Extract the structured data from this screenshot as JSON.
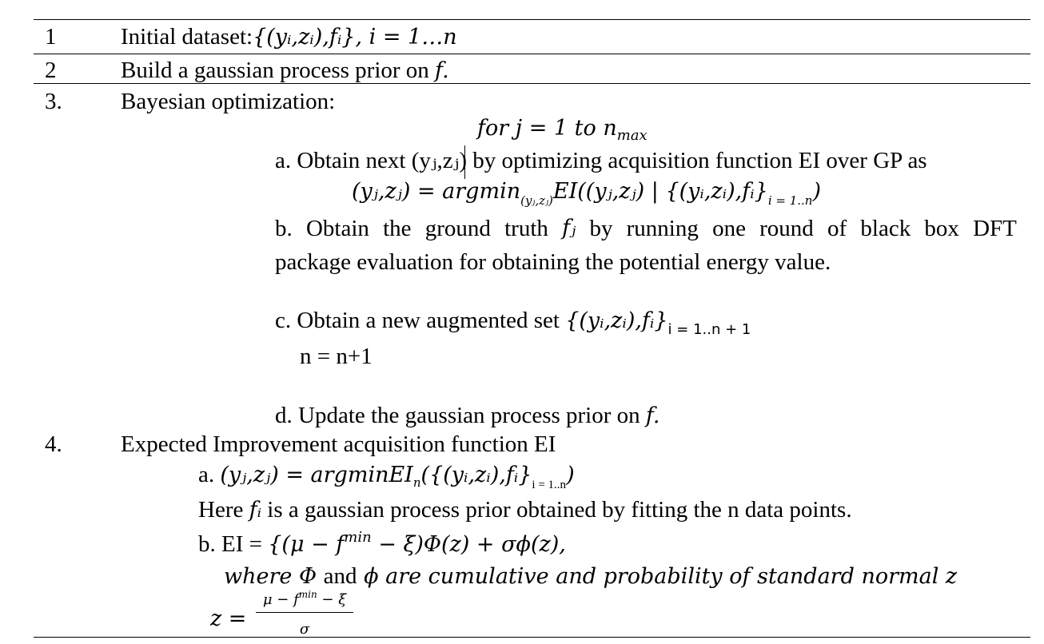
{
  "rows": [
    {
      "num": "1",
      "text": "Initial dataset:",
      "math": "{(yᵢ,zᵢ),fᵢ}, i = 1…n"
    },
    {
      "num": "2",
      "text": "Build a gaussian process prior on ",
      "math": "f."
    },
    {
      "num": "3.",
      "text": "Bayesian optimization:"
    },
    {
      "num": "4.",
      "text": "Expected Improvement acquisition function EI"
    }
  ],
  "step3": {
    "loop": "for j = 1 to n",
    "loop_sub": "max",
    "a_text": "a. Obtain next (yⱼ,zⱼ) by optimizing acquisition function EI over GP as",
    "a_eq": "(yⱼ,zⱼ) =  argmin",
    "a_eq_sub": "(yⱼ,zⱼ)",
    "a_eq_rest": "EI((yⱼ,zⱼ) | {(yᵢ,zᵢ),fᵢ}",
    "a_eq_rest_sub": "i = 1..n",
    "a_eq_close": ")",
    "b_line1_parts": [
      "b.",
      "Obtain",
      "the",
      "ground",
      "truth",
      "fⱼ",
      "by",
      "running",
      "one",
      "round",
      "of",
      "black",
      "box",
      "DFT"
    ],
    "b_line2": "package evaluation for obtaining the potential energy value.",
    "c_text": "c. Obtain a new augmented set ",
    "c_math": "{(yᵢ,zᵢ),fᵢ}",
    "c_sub": "i = 1..n + 1",
    "n_update": "n = n+1",
    "d_text": "d. Update the gaussian process prior on ",
    "d_math": "f."
  },
  "step4": {
    "a_label": "a. ",
    "a_eq": "(yⱼ,zⱼ) =  argminEI",
    "a_eq_sub_n": "n",
    "a_eq_rest": "({(yᵢ,zᵢ),fᵢ}",
    "a_eq_rest_sub": "i = 1..n",
    "a_eq_close": ")",
    "here_text_1": "Here ",
    "here_math": "fᵢ",
    "here_text_2": " is a gaussian process prior obtained by fitting the n data points.",
    "b_label": "b. EI = ",
    "b_eq_1": "{(μ −  f",
    "b_eq_sup": "min",
    "b_eq_2": " −  ξ)Φ(z) + σϕ(z),",
    "where_1": "where Φ ",
    "where_and": "and",
    "where_2": " ϕ are cumulative and probability of standard normal z",
    "z_lhs": "z =",
    "z_num": "μ − f",
    "z_num_sup": "min",
    "z_num_end": " − ξ",
    "z_den": "σ"
  }
}
